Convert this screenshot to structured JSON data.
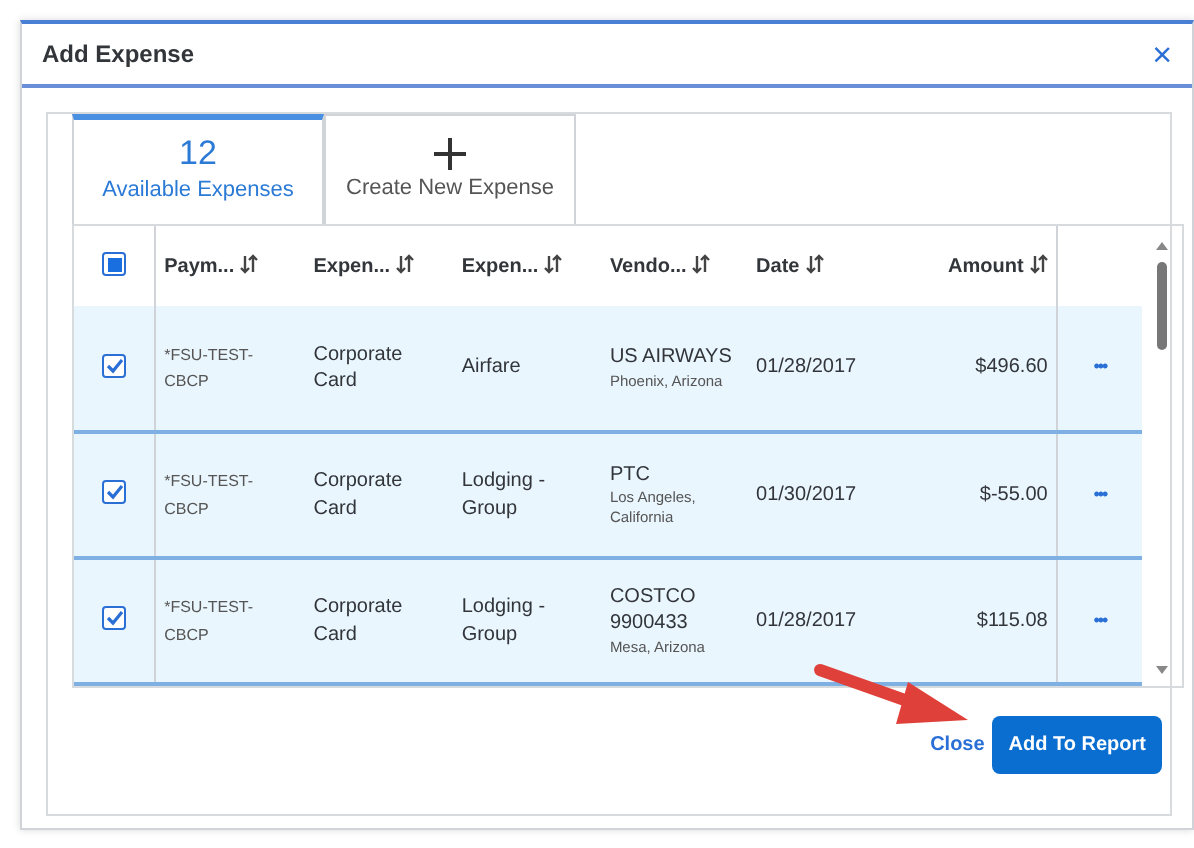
{
  "window": {
    "title": "Add Expense",
    "close": "×"
  },
  "tabs": [
    {
      "kind": "count",
      "value": "12",
      "label": "Available Expenses",
      "selected": true
    },
    {
      "kind": "create",
      "label": "Create New Expense",
      "selected": false
    }
  ],
  "table": {
    "select_all": {
      "checked": true
    },
    "columns": [
      "Paym...",
      "Expen...",
      "Expen...",
      "Vendo...",
      "Date",
      "Amount"
    ],
    "rows": [
      {
        "selected": true,
        "checked": true,
        "payment": "*FSU-TEST-CBCP",
        "expense_type": "Corporate Card",
        "expense": "Airfare",
        "vendor": "US AIRWAYS",
        "location": "Phoenix, Arizona",
        "date": "01/28/2017",
        "amount": "$496.60",
        "more": "•••"
      },
      {
        "selected": true,
        "checked": true,
        "payment": "*FSU-TEST-CBCP",
        "expense_type": "Corporate Card",
        "expense": "Lodging - Group",
        "vendor": "PTC",
        "location": "Los Angeles, California",
        "date": "01/30/2017",
        "amount": "$-55.00",
        "more": "•••"
      },
      {
        "selected": true,
        "checked": true,
        "payment": "*FSU-TEST-CBCP",
        "expense_type": "Corporate Card",
        "expense": "Lodging - Group",
        "vendor": "COSTCO 9900433",
        "location": "Mesa, Arizona",
        "date": "01/28/2017",
        "amount": "$115.08",
        "more": "•••"
      }
    ]
  },
  "buttons": [
    {
      "kind": "link",
      "label": "Close"
    },
    {
      "kind": "primary",
      "label": "Add To Report"
    }
  ]
}
